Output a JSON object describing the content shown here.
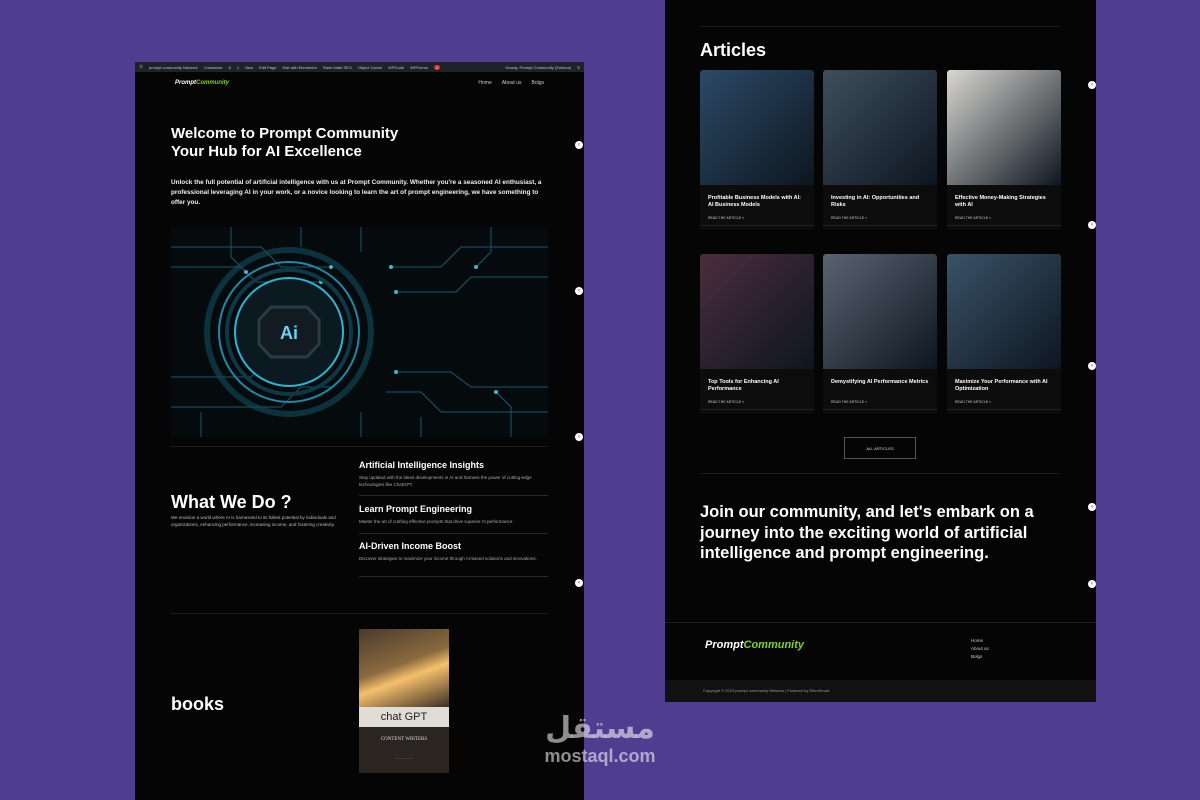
{
  "colors": {
    "background": "#4f3d8f",
    "panel": "#050505",
    "accent": "#7ed321"
  },
  "admin_bar": {
    "items": [
      "prompt community Network",
      "Customize",
      "6",
      "1",
      "New",
      "Edit Page",
      "Edit with Elementor",
      "Rank Math SEO",
      "Object Cache",
      "WPCode",
      "WPForms"
    ],
    "badge": "1",
    "greeting": "Howdy, Prompt Community (Sohima)"
  },
  "site": {
    "logo_prefix": "Prompt",
    "logo_suffix": "Community",
    "menu": [
      "Home",
      "About us",
      "Bolgs"
    ]
  },
  "hero": {
    "title_line1": "Welcome to Prompt Community",
    "title_line2": "Your Hub for AI Excellence",
    "text": "Unlock the full potential of artificial intelligence with us at Prompt Community. Whether you're a seasoned AI enthusiast, a professional leveraging AI in your work, or a novice looking to learn the art of prompt engineering, we have something to offer you.",
    "chip_label": "Ai"
  },
  "what_we_do": {
    "title": "What We Do ?",
    "text": "We envision a world where AI is harnessed to its fullest potential by individuals and organizations, enhancing performance, increasing income, and fostering creativity.",
    "services": [
      {
        "title": "Artificial Intelligence Insights",
        "text": "Stay updated with the latest developments in AI and harness the power of cutting-edge technologies like ChatGPT."
      },
      {
        "title": "Learn Prompt Engineering",
        "text": "Master the art of crafting effective prompts that drive superior AI performance."
      },
      {
        "title": "AI-Driven Income Boost",
        "text": "Discover strategies to maximize your income through AI-based solutions and innovations."
      }
    ]
  },
  "books": {
    "title": "books",
    "cover_title": "chat GPT",
    "cover_subtitle": "CONTENT WRITERS"
  },
  "articles": {
    "title": "Articles",
    "read_more": "READ THE ARTICLE »",
    "cards": [
      {
        "title": "Profitable Business Models with AI: AI Business Models",
        "author": "Prompt Community Network",
        "date": "November 5, 2023",
        "color": "#2c4a66"
      },
      {
        "title": "Investing in AI: Opportunities and Risks",
        "author": "Prompt Community Eadmar",
        "date": "November 5, 2023",
        "color": "#3d4f5c"
      },
      {
        "title": "Effective Money-Making Strategies with AI",
        "author": "Prompt Community Network",
        "date": "November 5, 2023",
        "color": "#d9d7d2"
      },
      {
        "title": "Top Tools for Enhancing AI Performance",
        "author": "Prompt Community Network",
        "date": "October 30, 2023",
        "color": "#4a2d3e"
      },
      {
        "title": "Demystifying AI Performance Metrics",
        "author": "Prompt Community Eadmar",
        "date": "October 30, 2023",
        "color": "#5a6470"
      },
      {
        "title": "Maximize Your Performance with AI Optimization",
        "author": "Prompt Community Network",
        "date": "October 29, 2023",
        "color": "#3a5268"
      }
    ],
    "all_button": "ALL ARTICLES"
  },
  "join": {
    "text": "Join our community, and let's embark on a journey into the exciting world of artificial intelligence and prompt engineering."
  },
  "footer": {
    "links": [
      "Home",
      "About us",
      "Bolgs"
    ],
    "copyright": "Copyright © 2023 prompt community Network | Powered by ElemSmart"
  },
  "watermark": {
    "arabic": "مستقل",
    "latin": "mostaql.com"
  }
}
